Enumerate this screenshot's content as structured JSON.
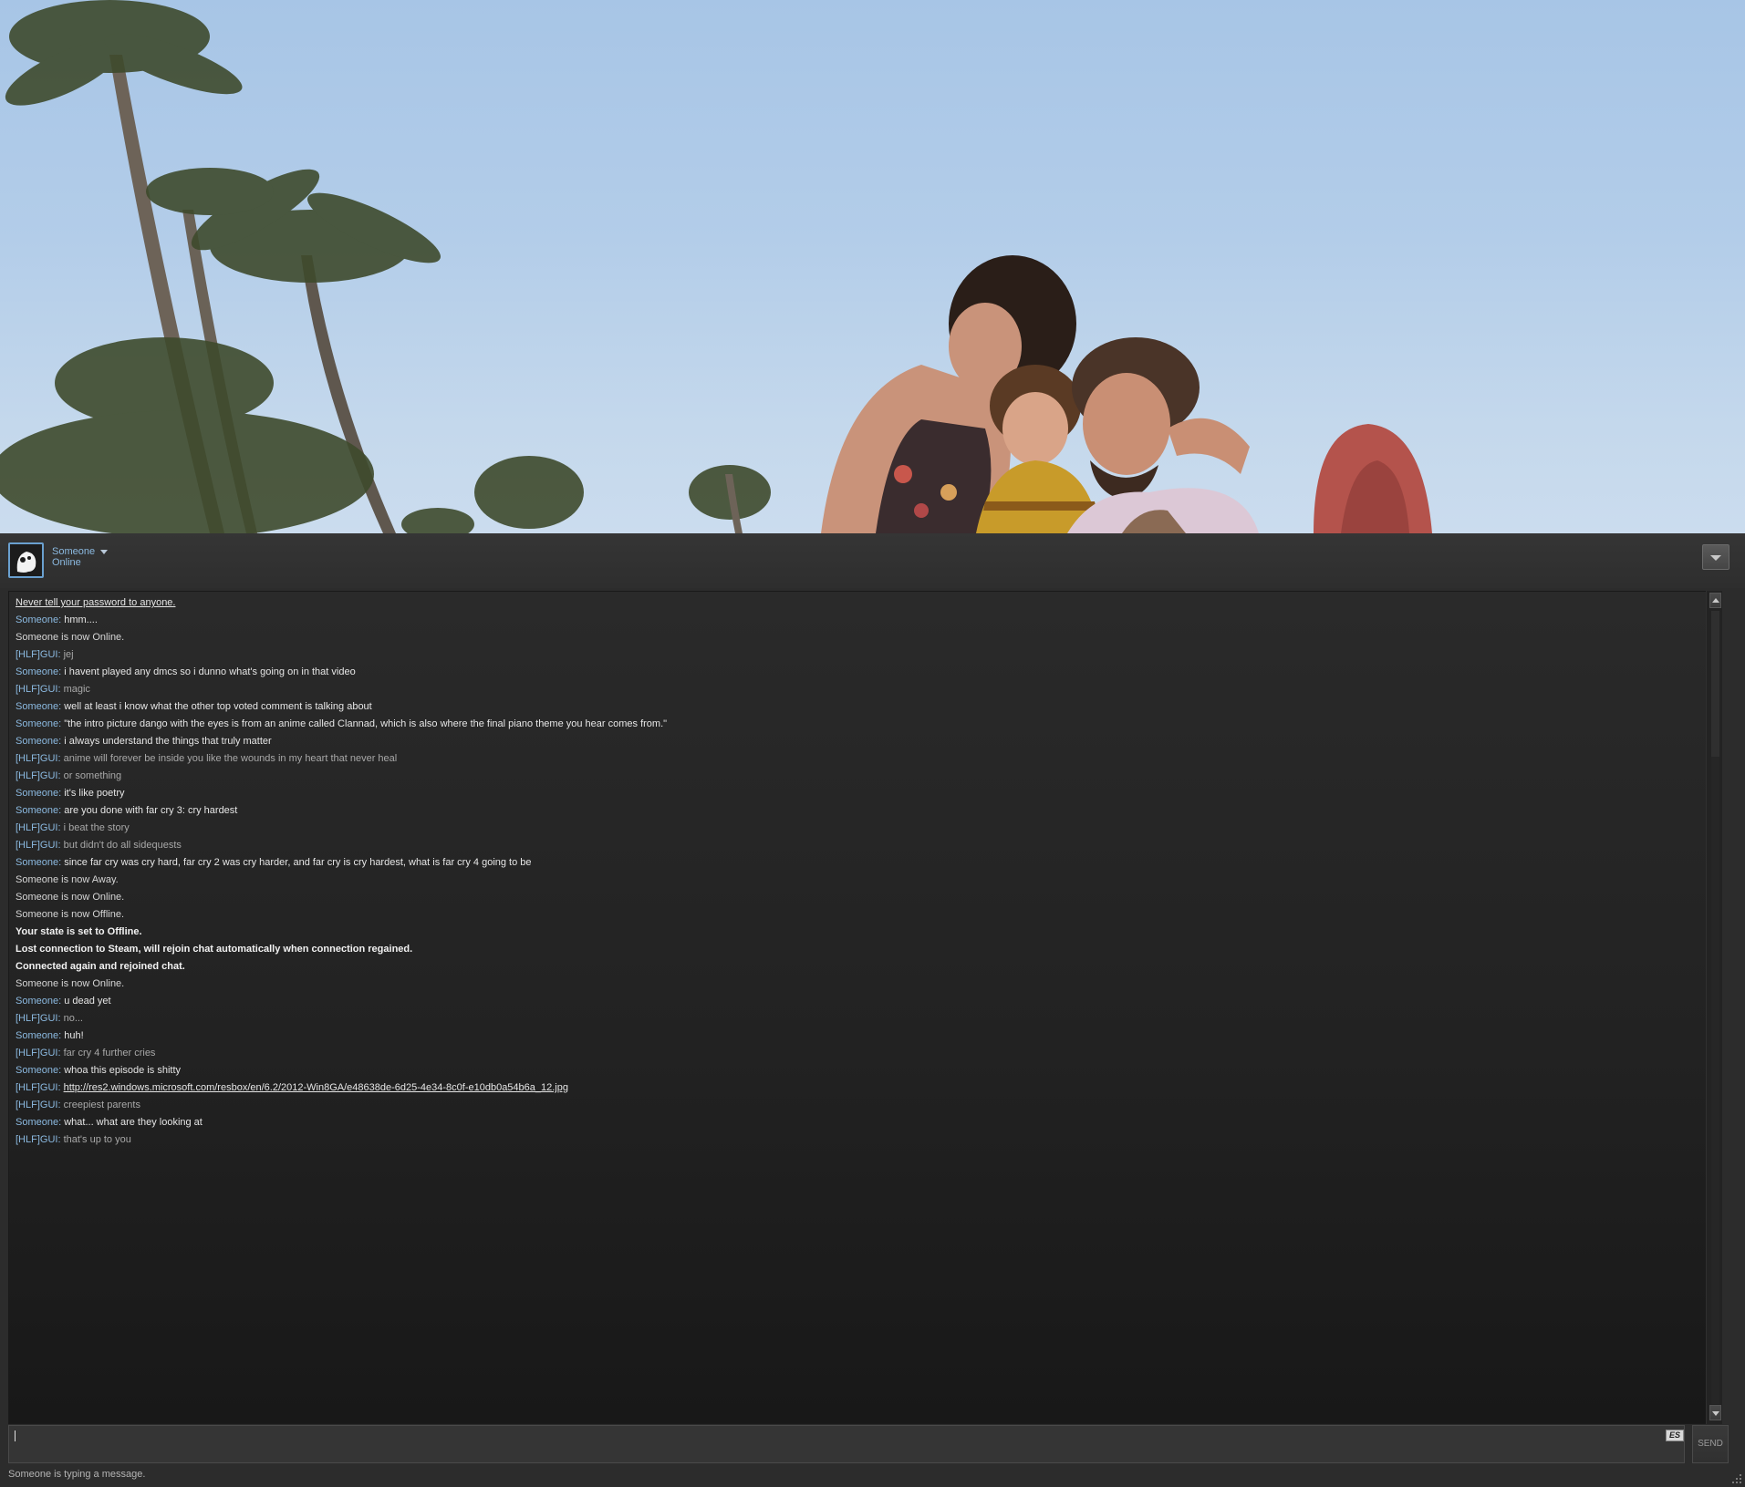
{
  "header": {
    "friend_name": "Someone",
    "friend_status": "Online",
    "avatar_icon": "ghost-avatar-icon",
    "menu_icon": "chevron-down-icon"
  },
  "messages": [
    {
      "kind": "link-system",
      "text": "Never tell your password to anyone."
    },
    {
      "kind": "them",
      "who": "Someone",
      "text": "hmm...."
    },
    {
      "kind": "system",
      "text": "Someone is now Online."
    },
    {
      "kind": "me",
      "who": "[HLF]GUI",
      "text": "jej"
    },
    {
      "kind": "them",
      "who": "Someone",
      "text": "i havent played any dmcs so i dunno what's going on in that video"
    },
    {
      "kind": "me",
      "who": "[HLF]GUI",
      "text": "magic"
    },
    {
      "kind": "them",
      "who": "Someone",
      "text": "well at least i know what the other top voted comment is talking about"
    },
    {
      "kind": "them",
      "who": "Someone",
      "text": "\"the intro picture dango with the eyes is from an anime called Clannad, which is also where the final piano theme you hear comes from.\""
    },
    {
      "kind": "them",
      "who": "Someone",
      "text": "i always understand the things that truly matter"
    },
    {
      "kind": "me",
      "who": "[HLF]GUI",
      "text": "anime will forever be inside you like the wounds in my heart that never heal"
    },
    {
      "kind": "me",
      "who": "[HLF]GUI",
      "text": "or something"
    },
    {
      "kind": "them",
      "who": "Someone",
      "text": "it's like poetry"
    },
    {
      "kind": "them",
      "who": "Someone",
      "text": "are you done with far cry 3: cry hardest"
    },
    {
      "kind": "me",
      "who": "[HLF]GUI",
      "text": "i beat the story"
    },
    {
      "kind": "me",
      "who": "[HLF]GUI",
      "text": "but didn't do all sidequests"
    },
    {
      "kind": "them",
      "who": "Someone",
      "text": "since far cry was cry hard, far cry 2 was cry harder, and far cry is cry hardest, what is far cry 4 going to be"
    },
    {
      "kind": "system",
      "text": "Someone is now Away."
    },
    {
      "kind": "system",
      "text": "Someone is now Online."
    },
    {
      "kind": "system",
      "text": "Someone is now Offline."
    },
    {
      "kind": "bold",
      "text": "Your state is set to Offline."
    },
    {
      "kind": "bold",
      "text": "Lost connection to Steam, will rejoin chat automatically when connection regained."
    },
    {
      "kind": "bold",
      "text": "Connected again and rejoined chat."
    },
    {
      "kind": "system",
      "text": "Someone is now Online."
    },
    {
      "kind": "them",
      "who": "Someone",
      "text": "u dead yet"
    },
    {
      "kind": "me",
      "who": "[HLF]GUI",
      "text": "no..."
    },
    {
      "kind": "them",
      "who": "Someone",
      "text": "huh!"
    },
    {
      "kind": "me",
      "who": "[HLF]GUI",
      "text": "far cry 4 further cries"
    },
    {
      "kind": "them",
      "who": "Someone",
      "text": "whoa this episode is shitty"
    },
    {
      "kind": "me-link",
      "who": "[HLF]GUI",
      "text": "http://res2.windows.microsoft.com/resbox/en/6.2/2012-Win8GA/e48638de-6d25-4e34-8c0f-e10db0a54b6a_12.jpg"
    },
    {
      "kind": "me",
      "who": "[HLF]GUI",
      "text": "creepiest parents"
    },
    {
      "kind": "them",
      "who": "Someone",
      "text": "what... what are they looking at"
    },
    {
      "kind": "me",
      "who": "[HLF]GUI",
      "text": "that's up to you"
    }
  ],
  "input": {
    "value": "",
    "emote_label": "ES",
    "send_label": "SEND"
  },
  "footer": {
    "typing_status": "Someone is typing a message."
  },
  "colors": {
    "name": "#8bb9e0",
    "text_them": "#e6e6e6",
    "text_me": "#a8a8a8",
    "bg": "#2c2c2c"
  }
}
